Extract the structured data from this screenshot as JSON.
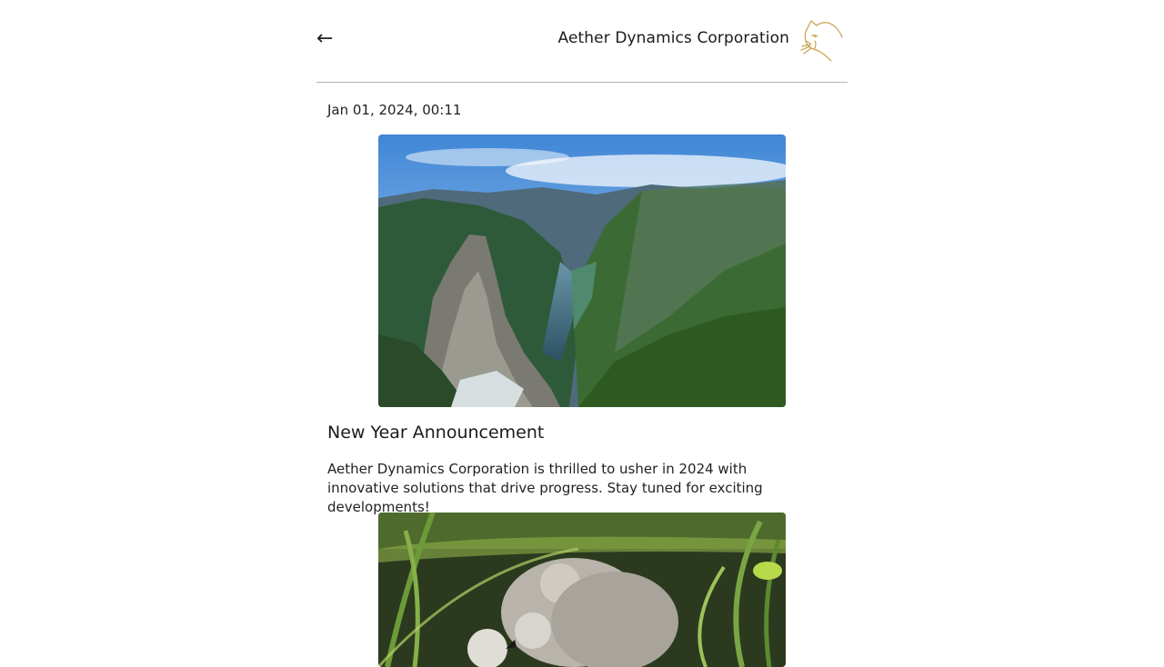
{
  "header": {
    "back_icon": "left-arrow-icon",
    "back_glyph": "←",
    "company_name": "Aether Dynamics Corporation",
    "logo_icon": "cat-logo-icon"
  },
  "post": {
    "date": "Jan 01, 2024, 00:11",
    "image_1": "fjord-mountain-photo",
    "title": "New Year Announcement",
    "body": "Aether Dynamics Corporation is thrilled to usher in 2024 with innovative solutions that drive progress. Stay tuned for exciting developments!",
    "image_2": "cygnets-in-grass-photo"
  },
  "colors": {
    "logo_gold": "#c9a04a",
    "divider": "#b5b5b5",
    "text": "#1a1a1a"
  }
}
